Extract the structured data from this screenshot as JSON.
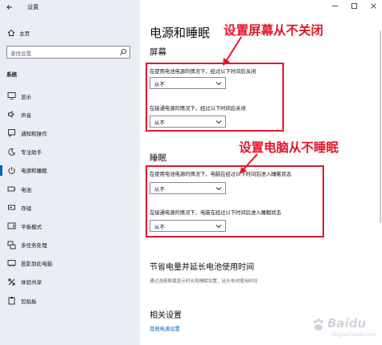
{
  "window": {
    "app_title": "设置"
  },
  "sidebar": {
    "home_label": "主页",
    "search_placeholder": "查找设置",
    "section_label": "系统",
    "items": [
      {
        "label": "显示",
        "icon": "display-icon"
      },
      {
        "label": "声音",
        "icon": "speaker-icon"
      },
      {
        "label": "通知和操作",
        "icon": "notification-icon"
      },
      {
        "label": "专注助手",
        "icon": "moon-icon"
      },
      {
        "label": "电源和睡眠",
        "icon": "power-icon",
        "active": true
      },
      {
        "label": "电池",
        "icon": "battery-icon"
      },
      {
        "label": "存储",
        "icon": "storage-icon"
      },
      {
        "label": "平板模式",
        "icon": "tablet-icon"
      },
      {
        "label": "多任务处理",
        "icon": "multitask-icon"
      },
      {
        "label": "投影到此电脑",
        "icon": "projector-icon"
      },
      {
        "label": "体验共享",
        "icon": "share-icon"
      },
      {
        "label": "剪贴板",
        "icon": "clipboard-icon"
      }
    ]
  },
  "main": {
    "page_title": "电源和睡眠",
    "screen": {
      "heading": "屏幕",
      "battery_label": "在使用电池电源的情况下，经过以下时间后关闭",
      "battery_value": "从不",
      "plugged_label": "在接通电源的情况下，经过以下时间后关闭",
      "plugged_value": "从不"
    },
    "sleep": {
      "heading": "睡眠",
      "battery_label": "在使用电池电源的情况下，电脑在经过以下时间后进入睡眠状态",
      "battery_value": "从不",
      "plugged_label": "在接通电源的情况下，电脑在经过以下时间后进入睡眠状态",
      "plugged_value": "从不"
    },
    "battery_section": {
      "heading": "节省电量并延长电池使用时间",
      "description": "通过选择屏幕显示时长和睡眠设置，延长电池使用时间"
    },
    "related": {
      "heading": "相关设置",
      "link": "其他电源设置"
    }
  },
  "annotations": {
    "screen_note": "设置屏幕从不关闭",
    "sleep_note": "设置电脑从不睡眠",
    "color": "#e3162a"
  },
  "watermark": {
    "text": "Baidu",
    "sub": "jingyan.baidu.com"
  },
  "colors": {
    "accent": "#0063b1",
    "sidebar_bg": "#e9eef4"
  }
}
